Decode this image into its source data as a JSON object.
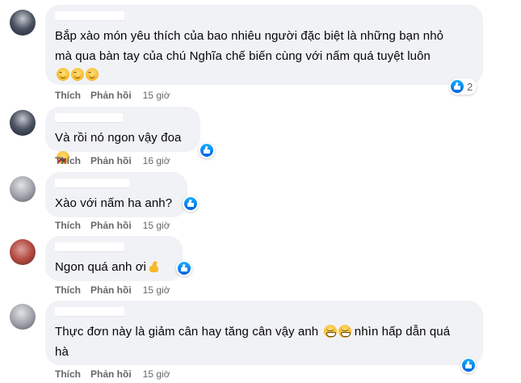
{
  "actions": {
    "like_label": "Thích",
    "reply_label": "Phản hồi"
  },
  "comments": [
    {
      "text_line1": "Bắp xào món yêu thích của bao nhiêu người đặc biệt là những bạn nhỏ",
      "text_line2": "mà qua bàn tay của chú Nghĩa chế biến cùng với nấm quá tuyệt luôn",
      "emojis": [
        "smile-emoji",
        "smile-emoji",
        "smile-emoji"
      ],
      "like_count": "2",
      "time": "15 giờ"
    },
    {
      "text": "Và rồi nó ngon vậy đoa",
      "emojis": [
        "heart-eyes-emoji"
      ],
      "time": "16 giờ"
    },
    {
      "text": "Xào với nấm ha anh?",
      "time": "15 giờ"
    },
    {
      "text": "Ngon quá anh ơi",
      "emojis": [
        "thumbs-up-emoji"
      ],
      "time": "15 giờ"
    },
    {
      "text_before": "Thực đơn này là giảm cân hay tăng cân vậy anh",
      "text_after": "nhìn hấp dẫn quá",
      "text_line2": "hà",
      "emojis": [
        "grin-emoji",
        "grin-emoji"
      ],
      "time": "15 giờ"
    }
  ],
  "colors": {
    "bubble": "#f0f2f5",
    "meta_text": "#65676b",
    "like_blue": "#1877f2",
    "background": "#ffffff"
  }
}
